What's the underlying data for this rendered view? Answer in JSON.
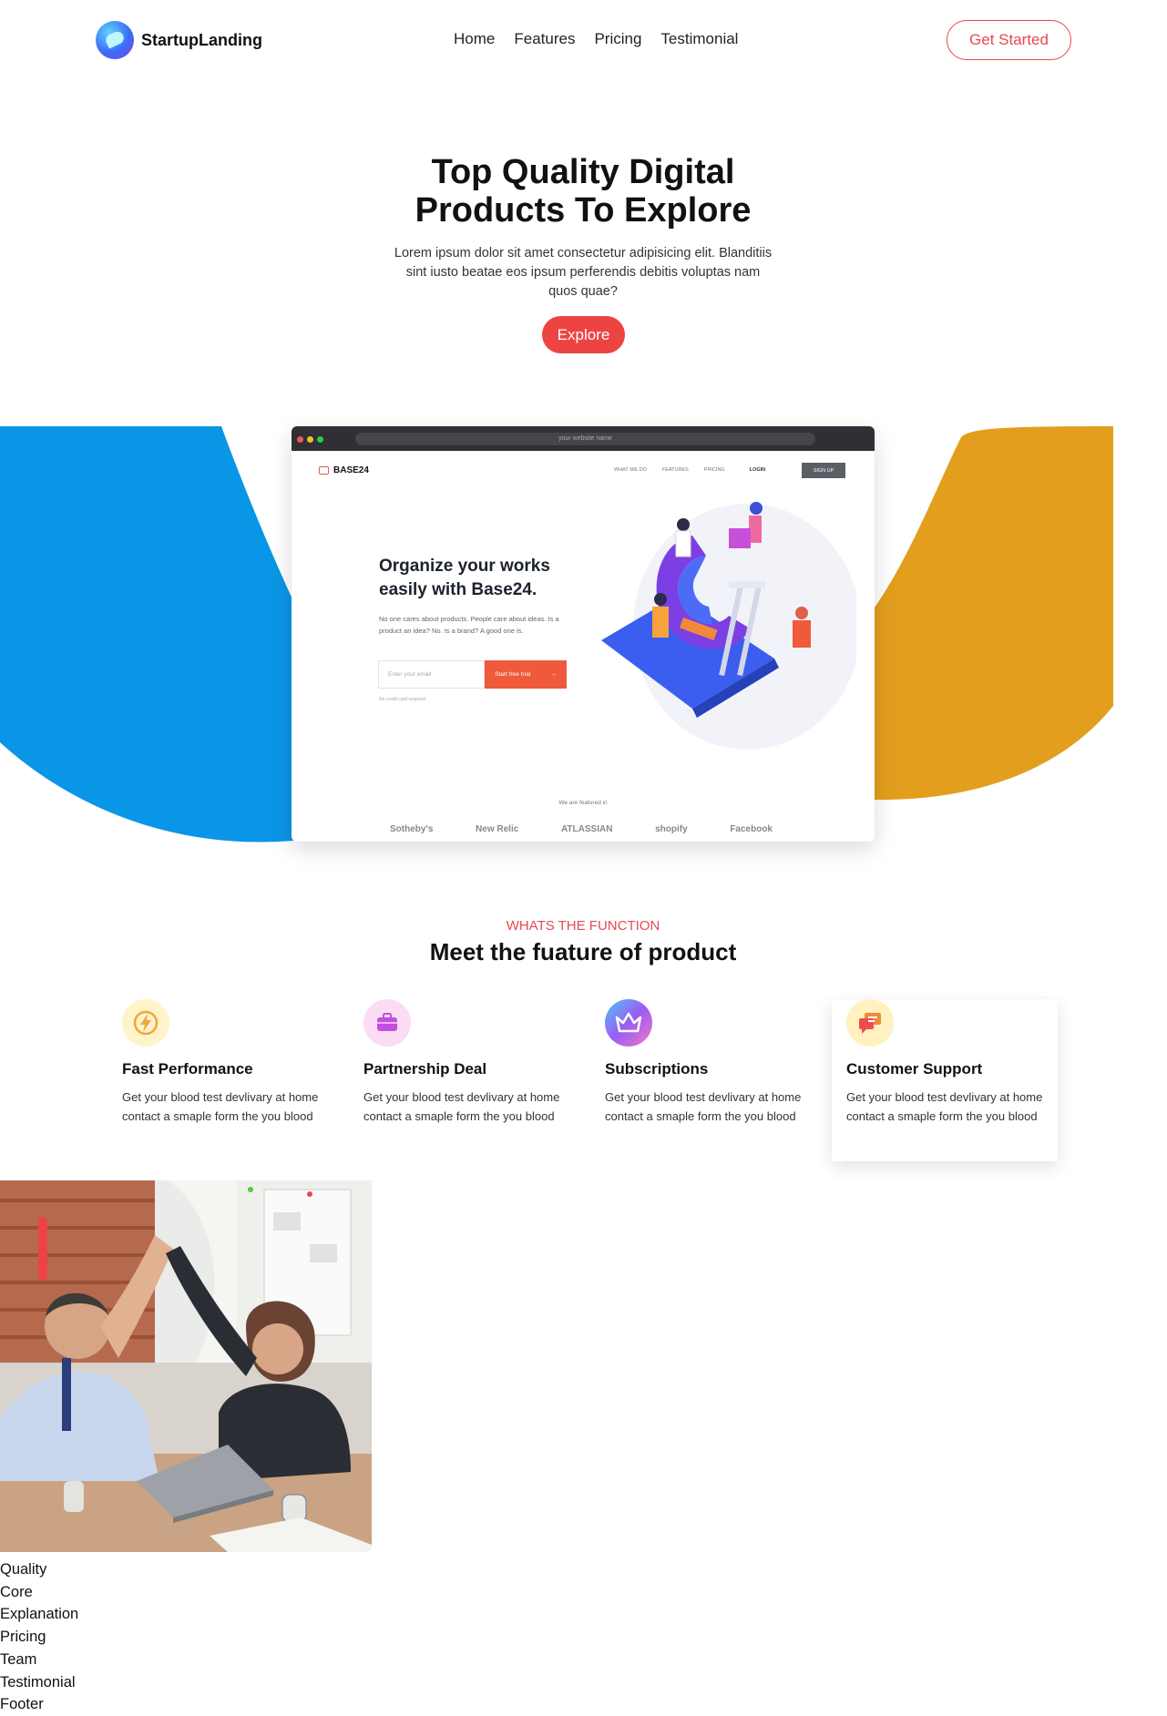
{
  "header": {
    "brand": "StartupLanding",
    "nav": [
      "Home",
      "Features",
      "Pricing",
      "Testimonial"
    ],
    "cta": "Get Started"
  },
  "hero": {
    "title_line1": "Top Quality Digital",
    "title_line2": "Products To Explore",
    "text": "Lorem ipsum dolor sit amet consectetur adipisicing elit. Blanditiis sint iusto beatae eos ipsum perferendis debitis voluptas nam quos quae?",
    "button": "Explore"
  },
  "mockup": {
    "url": "your website name",
    "brand": "BASE24",
    "nav": [
      "WHAT WE DO",
      "FEATURES",
      "PRICING",
      "LOGIN"
    ],
    "signup": "SIGN UP",
    "headline": "Organize your works easily with Base24.",
    "text": "No one cares about products. People care about ideas. Is a product an idea? No. Is a brand? A good one is.",
    "input_placeholder": "Enter your email",
    "button": "Start free trial",
    "button_arrow": "→",
    "small": "No credit card required",
    "featured": "We are featured in",
    "brands": [
      "Sotheby's",
      "New Relic",
      "ATLASSIAN",
      "shopify",
      "Facebook"
    ]
  },
  "functions": {
    "eyebrow": "WHATS THE FUNCTION",
    "title": "Meet the fuature of product",
    "cards": [
      {
        "title": "Fast Performance",
        "text": "Get your blood test devlivary at home contact a smaple form the you blood",
        "icon": "lightning-icon"
      },
      {
        "title": "Partnership Deal",
        "text": "Get your blood test devlivary at home contact a smaple form the you blood",
        "icon": "briefcase-icon"
      },
      {
        "title": "Subscriptions",
        "text": "Get your blood test devlivary at home contact a smaple form the you blood",
        "icon": "crown-icon"
      },
      {
        "title": "Customer Support",
        "text": "Get your blood test devlivary at home contact a smaple form the you blood",
        "icon": "chat-icon"
      }
    ]
  },
  "footer_links": [
    "Quality",
    "Core",
    "Explanation",
    "Pricing",
    "Team",
    "Testimonial",
    "Footer"
  ],
  "colors": {
    "accent": "#ee4343",
    "blue": "#0a96e6",
    "gold": "#e39e1e"
  }
}
